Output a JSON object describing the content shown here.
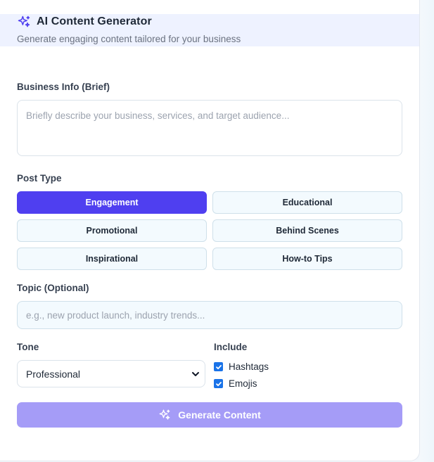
{
  "header": {
    "title": "AI Content Generator",
    "subtitle": "Generate engaging content tailored for your business",
    "icon": "sparkle-icon"
  },
  "business_info": {
    "label": "Business Info (Brief)",
    "value": "",
    "placeholder": "Briefly describe your business, services, and target audience..."
  },
  "post_type": {
    "label": "Post Type",
    "selected": "Engagement",
    "options": [
      "Engagement",
      "Educational",
      "Promotional",
      "Behind Scenes",
      "Inspirational",
      "How-to Tips"
    ]
  },
  "topic": {
    "label": "Topic (Optional)",
    "value": "",
    "placeholder": "e.g., new product launch, industry trends..."
  },
  "tone": {
    "label": "Tone",
    "selected": "Professional",
    "icon": "chevron-down-icon"
  },
  "include": {
    "label": "Include",
    "hashtags": {
      "label": "Hashtags",
      "checked": true
    },
    "emojis": {
      "label": "Emojis",
      "checked": true
    }
  },
  "generate": {
    "label": "Generate Content",
    "icon": "sparkle-icon"
  },
  "colors": {
    "accent": "#4f3ff0",
    "accent_disabled": "#a59cf7",
    "checkbox": "#1a73e8",
    "header_bg": "#eef2ff"
  }
}
